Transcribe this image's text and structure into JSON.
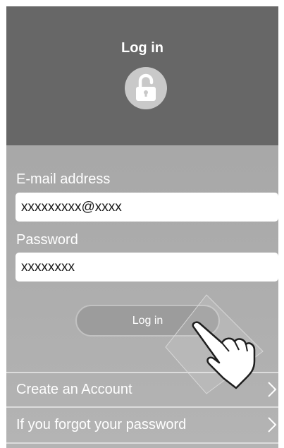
{
  "header": {
    "title": "Log in",
    "icon": "unlocked-padlock-icon"
  },
  "form": {
    "email": {
      "label": "E-mail address",
      "value": "xxxxxxxxx@xxxx"
    },
    "password": {
      "label": "Password",
      "value": "xxxxxxxx"
    },
    "submit_label": "Log in"
  },
  "menu": {
    "create_account": "Create an Account",
    "forgot_password": "If you forgot your password"
  },
  "overlay": {
    "icon": "tapping-hand-icon"
  },
  "colors": {
    "header_background": "#676767",
    "body_background": "#a9a9a9",
    "button_fill": "#9c9c9c",
    "text": "#ffffff"
  }
}
